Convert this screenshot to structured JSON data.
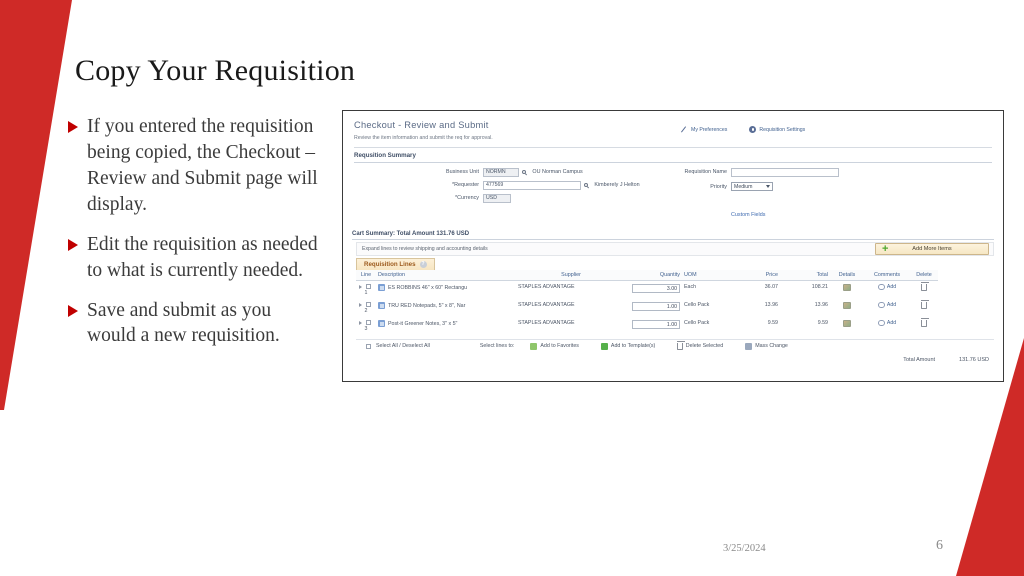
{
  "slide": {
    "title": "Copy Your Requisition",
    "bullets": [
      "If you entered the requisition being copied, the Checkout – Review and Submit page will display.",
      "Edit the requisition as needed to what is currently needed.",
      "Save and submit as you would a new requisition."
    ],
    "footer_date": "3/25/2024",
    "footer_page": "6",
    "accent_color": "#cf2a27",
    "bullet_marker_color": "#c00000"
  },
  "screenshot": {
    "page_title": "Checkout - Review and Submit",
    "page_subtitle": "Review the item information and submit the req for approval.",
    "toolbar": [
      {
        "label": "My Preferences",
        "icon": "pen-icon"
      },
      {
        "label": "Requisition Settings",
        "icon": "gear-icon"
      }
    ],
    "requisition_summary": {
      "section_title": "Requsition Summary",
      "business_unit_label": "Business Unit",
      "business_unit_value": "NORMN",
      "business_unit_desc": "OU Norman Campus",
      "requester_label": "*Requester",
      "requester_value": "477569",
      "requester_desc": "Kimberely J Helton",
      "currency_label": "*Currency",
      "currency_value": "USD",
      "requisition_name_label": "Requisition Name",
      "requisition_name_value": "",
      "priority_label": "Priority",
      "priority_value": "Medium",
      "custom_fields_link": "Custom Fields"
    },
    "cart": {
      "summary_title": "Cart Summary: Total Amount 131.76 USD",
      "expand_hint": "Expand lines to review shipping and accounting details",
      "add_more_items_label": "Add More Items",
      "lines_tab_label": "Requisition Lines",
      "lines_tab_badge": "?"
    },
    "table": {
      "columns": [
        "Line",
        "Description",
        "Supplier",
        "Quantity",
        "UOM",
        "Price",
        "Total",
        "Details",
        "Comments",
        "Delete"
      ],
      "rows": [
        {
          "line": "1",
          "description": "ES ROBBINS 46\" x 60\" Rectangu",
          "supplier": "STAPLES ADVANTAGE",
          "quantity": "3.00",
          "uom": "Each",
          "price": "36.07",
          "total": "108.21",
          "comments_label": "Add"
        },
        {
          "line": "2",
          "description": "TRU RED Notepads, 5\" x 8\", Nar",
          "supplier": "STAPLES ADVANTAGE",
          "quantity": "1.00",
          "uom": "Cello Pack",
          "price": "13.96",
          "total": "13.96",
          "comments_label": "Add"
        },
        {
          "line": "3",
          "description": "Post-it Greener Notes, 3\" x 5\"",
          "supplier": "STAPLES ADVANTAGE",
          "quantity": "1.00",
          "uom": "Cello Pack",
          "price": "9.59",
          "total": "9.59",
          "comments_label": "Add"
        }
      ]
    },
    "actions": {
      "select_all_label": "Select All / Deselect All",
      "select_lines_to_label": "Select lines to:",
      "add_to_favorites": "Add to Favorites",
      "add_to_templates": "Add to Template(s)",
      "delete_selected": "Delete Selected",
      "mass_change": "Mass Change"
    },
    "totals": {
      "label": "Total Amount",
      "value": "131.76 USD"
    }
  }
}
